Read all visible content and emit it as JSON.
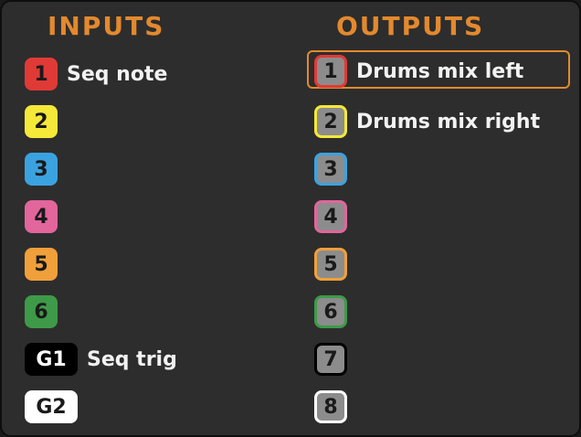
{
  "inputs": {
    "heading": "INPUTS",
    "rows": [
      {
        "badge": "1",
        "label": "Seq note",
        "color": "#e03a36",
        "text_color": "#1a1a1a"
      },
      {
        "badge": "2",
        "label": "",
        "color": "#f5e838",
        "text_color": "#1a1a1a"
      },
      {
        "badge": "3",
        "label": "",
        "color": "#3ba2e0",
        "text_color": "#1a1a1a"
      },
      {
        "badge": "4",
        "label": "",
        "color": "#e2659b",
        "text_color": "#1a1a1a"
      },
      {
        "badge": "5",
        "label": "",
        "color": "#f0a03a",
        "text_color": "#1a1a1a"
      },
      {
        "badge": "6",
        "label": "",
        "color": "#3e9a48",
        "text_color": "#1a1a1a"
      },
      {
        "badge": "G1",
        "label": "Seq trig",
        "color": "#000000",
        "text_color": "#ffffff"
      },
      {
        "badge": "G2",
        "label": "",
        "color": "#ffffff",
        "text_color": "#1a1a1a"
      }
    ]
  },
  "outputs": {
    "heading": "OUTPUTS",
    "selected_index": 0,
    "rows": [
      {
        "badge": "1",
        "label": "Drums mix left",
        "color": "#e03a36"
      },
      {
        "badge": "2",
        "label": "Drums mix right",
        "color": "#f5e838"
      },
      {
        "badge": "3",
        "label": "",
        "color": "#3ba2e0"
      },
      {
        "badge": "4",
        "label": "",
        "color": "#e2659b"
      },
      {
        "badge": "5",
        "label": "",
        "color": "#f0a03a"
      },
      {
        "badge": "6",
        "label": "",
        "color": "#3e9a48"
      },
      {
        "badge": "7",
        "label": "",
        "color": "#000000"
      },
      {
        "badge": "8",
        "label": "",
        "color": "#ffffff"
      }
    ]
  },
  "colors": {
    "accent": "#e3892e",
    "panel_bg": "#2d2d2d",
    "output_fill": "#8c8c8c"
  }
}
